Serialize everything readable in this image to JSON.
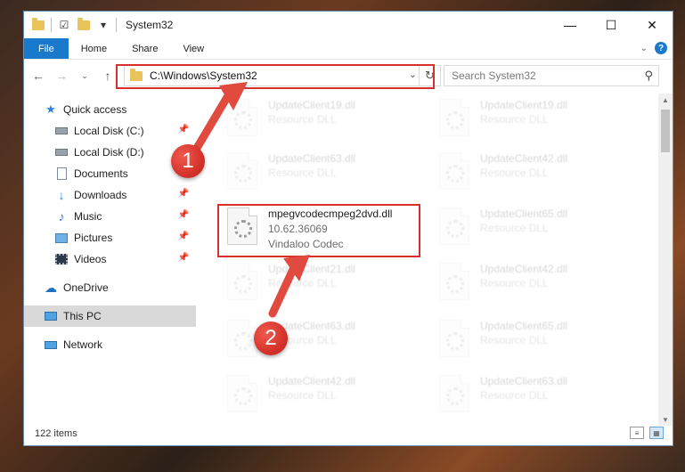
{
  "window": {
    "title": "System32",
    "controls": {
      "minimize": "—",
      "maximize": "☐",
      "close": "✕"
    }
  },
  "ribbon": {
    "tabs": [
      "File",
      "Home",
      "Share",
      "View"
    ],
    "help": "?"
  },
  "nav": {
    "address": "C:\\Windows\\System32",
    "search_placeholder": "Search System32"
  },
  "sidebar": {
    "items": [
      {
        "label": "Quick access",
        "icon": "star-icon",
        "pinned": false
      },
      {
        "label": "Local Disk (C:)",
        "icon": "drive-icon",
        "pinned": true
      },
      {
        "label": "Local Disk (D:)",
        "icon": "drive-icon",
        "pinned": false
      },
      {
        "label": "Documents",
        "icon": "documents-icon",
        "pinned": true
      },
      {
        "label": "Downloads",
        "icon": "download-icon",
        "pinned": true
      },
      {
        "label": "Music",
        "icon": "music-icon",
        "pinned": true
      },
      {
        "label": "Pictures",
        "icon": "pictures-icon",
        "pinned": true
      },
      {
        "label": "Videos",
        "icon": "videos-icon",
        "pinned": true
      },
      {
        "label": "OneDrive",
        "icon": "cloud-icon",
        "pinned": false
      },
      {
        "label": "This PC",
        "icon": "pc-icon",
        "pinned": false
      },
      {
        "label": "Network",
        "icon": "network-icon",
        "pinned": false
      }
    ]
  },
  "files": {
    "left": [
      {
        "name": "UpdateClient19.dll",
        "sub": "Resource DLL"
      },
      {
        "name": "UpdateClient63.dll",
        "sub": "Resource DLL"
      },
      {
        "name": "mpegvcodecmpeg2dvd.dll",
        "version": "10.62.36069",
        "company": "Vindaloo Codec"
      },
      {
        "name": "UpdateClient21.dll",
        "sub": "Resource DLL"
      },
      {
        "name": "UpdateClient63.dll",
        "sub": "Resource DLL"
      },
      {
        "name": "UpdateClient42.dll",
        "sub": "Resource DLL"
      }
    ],
    "right": [
      {
        "name": "UpdateClient19.dll",
        "sub": "Resource DLL"
      },
      {
        "name": "UpdateClient42.dll",
        "sub": "Resource DLL"
      },
      {
        "name": "UpdateClient65.dll",
        "sub": "Resource DLL"
      },
      {
        "name": "UpdateClient42.dll",
        "sub": "Resource DLL"
      },
      {
        "name": "UpdateClient65.dll",
        "sub": "Resource DLL"
      },
      {
        "name": "UpdateClient63.dll",
        "sub": "Resource DLL"
      }
    ]
  },
  "status": {
    "count": "122 items"
  },
  "annotations": {
    "step1": "1",
    "step2": "2",
    "highlight_color": "#d9302e"
  }
}
